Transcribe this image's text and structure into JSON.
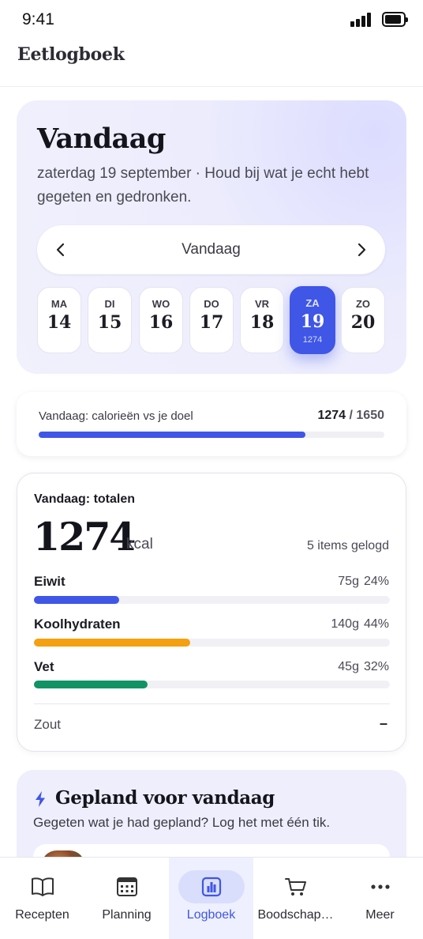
{
  "status_bar": {
    "time": "9:41"
  },
  "app": {
    "title": "Eetlogboek"
  },
  "hero": {
    "title": "Vandaag",
    "subtitle": "zaterdag 19 september · Houd bij wat je echt hebt gegeten en gedronken.",
    "nav_label": "Vandaag",
    "prev_icon": "chevron-left-icon",
    "next_icon": "chevron-right-icon",
    "days": [
      {
        "abbr": "MA",
        "num": "14"
      },
      {
        "abbr": "DI",
        "num": "15"
      },
      {
        "abbr": "WO",
        "num": "16"
      },
      {
        "abbr": "DO",
        "num": "17"
      },
      {
        "abbr": "VR",
        "num": "18"
      },
      {
        "abbr": "ZA",
        "num": "19",
        "kcal": "1274",
        "selected": true
      },
      {
        "abbr": "ZO",
        "num": "20"
      }
    ]
  },
  "calorie_progress": {
    "label": "Vandaag: calorieën vs je doel",
    "consumed": "1274",
    "separator": " / ",
    "goal": "1650",
    "fraction": 0.772,
    "color": "#3f56e6"
  },
  "totals": {
    "title": "Vandaag: totalen",
    "kcal": "1274",
    "unit": "kcal",
    "items_logged": "5 items gelogd",
    "macros": [
      {
        "name": "Eiwit",
        "grams": "75g",
        "percent": "24%",
        "fraction": 0.24,
        "color": "#3f56e6"
      },
      {
        "name": "Koolhydraten",
        "grams": "140g",
        "percent": "44%",
        "fraction": 0.44,
        "color": "#f5a00f"
      },
      {
        "name": "Vet",
        "grams": "45g",
        "percent": "32%",
        "fraction": 0.32,
        "color": "#119366"
      }
    ],
    "salt_label": "Zout",
    "salt_value": "–"
  },
  "planned": {
    "icon": "bolt-icon",
    "title": "Gepland voor vandaag",
    "subtitle": "Gegeten wat je had gepland? Log het met één tik."
  },
  "tabs": [
    {
      "label": "Recepten",
      "icon": "book-icon"
    },
    {
      "label": "Planning",
      "icon": "calendar-icon"
    },
    {
      "label": "Logboek",
      "icon": "chart-icon",
      "active": true
    },
    {
      "label": "Boodschap…",
      "icon": "cart-icon"
    },
    {
      "label": "Meer",
      "icon": "more-icon"
    }
  ],
  "colors": {
    "accent": "#3f56e6",
    "hero_bg": "#ececfd"
  }
}
